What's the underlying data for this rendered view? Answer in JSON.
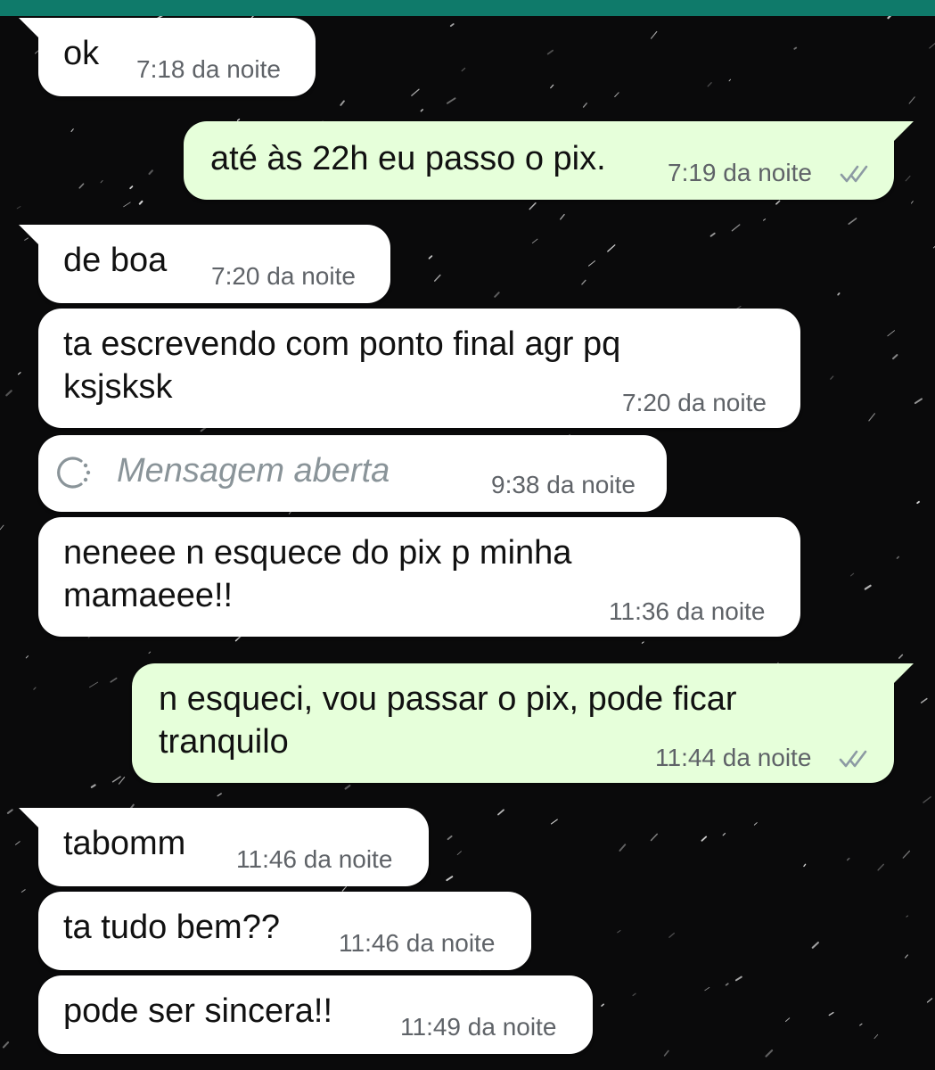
{
  "colors": {
    "top_bar": "#0f7a6a",
    "incoming_bubble": "#ffffff",
    "outgoing_bubble": "#e6ffda",
    "background": "#0a0a0b"
  },
  "messages": [
    {
      "direction": "incoming",
      "text_lines": [
        "ok"
      ],
      "time": "7:18 da noite"
    },
    {
      "direction": "outgoing",
      "text_lines": [
        "até às 22h eu passo o pix."
      ],
      "time": "7:19 da noite",
      "status_icon": "double-check-icon"
    },
    {
      "direction": "incoming",
      "text_lines": [
        "de boa"
      ],
      "time": "7:20 da noite"
    },
    {
      "direction": "incoming",
      "text_lines": [
        "ta escrevendo com ponto final agr pq",
        "ksjsksk"
      ],
      "time": "7:20 da noite"
    },
    {
      "direction": "incoming",
      "text_lines": [
        "Mensagem aberta"
      ],
      "time": "9:38 da noite",
      "icon": "view-once-opened-icon"
    },
    {
      "direction": "incoming",
      "text_lines": [
        "neneee n esquece do pix p minha",
        "mamaeee!!"
      ],
      "time": "11:36 da noite"
    },
    {
      "direction": "outgoing",
      "text_lines": [
        "n esqueci, vou passar o pix, pode ficar",
        "tranquilo"
      ],
      "time": "11:44 da noite",
      "status_icon": "double-check-icon"
    },
    {
      "direction": "incoming",
      "text_lines": [
        "tabomm"
      ],
      "time": "11:46 da noite"
    },
    {
      "direction": "incoming",
      "text_lines": [
        "ta tudo bem??"
      ],
      "time": "11:46 da noite"
    },
    {
      "direction": "incoming",
      "text_lines": [
        "pode ser sincera!!"
      ],
      "time": "11:49 da noite"
    }
  ]
}
